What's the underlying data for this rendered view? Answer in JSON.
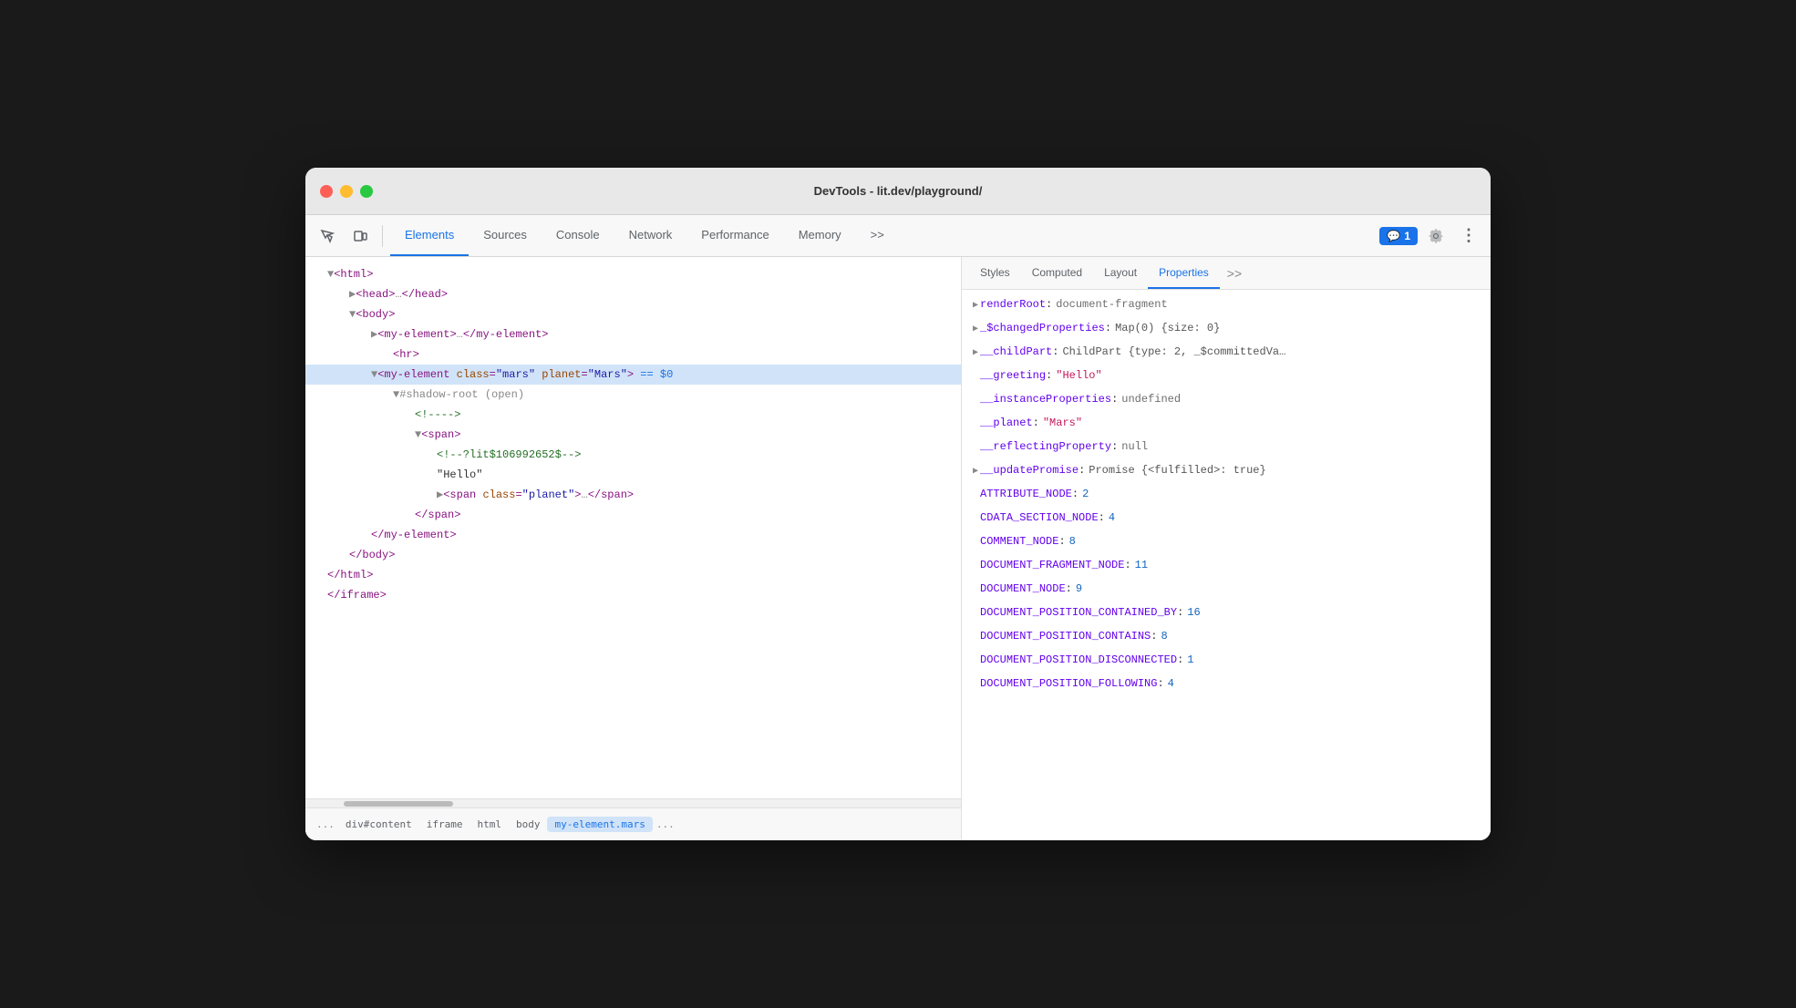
{
  "window": {
    "title": "DevTools - lit.dev/playground/"
  },
  "toolbar": {
    "tabs": [
      {
        "label": "Elements",
        "active": true
      },
      {
        "label": "Sources"
      },
      {
        "label": "Console"
      },
      {
        "label": "Network"
      },
      {
        "label": "Performance"
      },
      {
        "label": "Memory"
      },
      {
        "label": ">>"
      }
    ],
    "chat_badge": "1",
    "more_label": "⋮"
  },
  "sub_tabs": [
    {
      "label": "Styles"
    },
    {
      "label": "Computed"
    },
    {
      "label": "Layout"
    },
    {
      "label": "Properties",
      "active": true
    }
  ],
  "dom_tree": [
    {
      "indent": 1,
      "content": "▼ <html>"
    },
    {
      "indent": 2,
      "content": "▶ <head>…</head>"
    },
    {
      "indent": 2,
      "content": "▼ <body>"
    },
    {
      "indent": 3,
      "content": "▶ <my-element>…</my-element>"
    },
    {
      "indent": 4,
      "content": "<hr>"
    },
    {
      "indent": 3,
      "content": "▼ <my-element class=\"mars\" planet=\"Mars\"> == $0",
      "selected": true
    },
    {
      "indent": 4,
      "content": "▼ #shadow-root (open)"
    },
    {
      "indent": 5,
      "content": "<!---->"
    },
    {
      "indent": 5,
      "content": "▼ <span>"
    },
    {
      "indent": 6,
      "content": "<!--?lit$106992652$-->"
    },
    {
      "indent": 6,
      "content": "\"Hello\""
    },
    {
      "indent": 6,
      "content": "▶ <span class=\"planet\">…</span>"
    },
    {
      "indent": 5,
      "content": "</span>"
    },
    {
      "indent": 3,
      "content": "</my-element>"
    },
    {
      "indent": 2,
      "content": "</body>"
    },
    {
      "indent": 1,
      "content": "</html>"
    },
    {
      "indent": 1,
      "content": "</iframe>"
    }
  ],
  "breadcrumb": {
    "ellipsis": "...",
    "items": [
      {
        "label": "div#content"
      },
      {
        "label": "iframe"
      },
      {
        "label": "html"
      },
      {
        "label": "body"
      },
      {
        "label": "my-element.mars",
        "active": true
      }
    ],
    "more": "..."
  },
  "properties": [
    {
      "expandable": true,
      "key": "renderRoot",
      "value": "document-fragment",
      "type": "keyword"
    },
    {
      "expandable": true,
      "key": "_$changedProperties",
      "value": "Map(0) {size: 0}",
      "type": "object"
    },
    {
      "expandable": true,
      "key": "__childPart",
      "value": "ChildPart {type: 2, _$committedVa…",
      "type": "object"
    },
    {
      "expandable": false,
      "key": "__greeting",
      "value": "\"Hello\"",
      "type": "string"
    },
    {
      "expandable": false,
      "key": "__instanceProperties",
      "value": "undefined",
      "type": "keyword"
    },
    {
      "expandable": false,
      "key": "__planet",
      "value": "\"Mars\"",
      "type": "string"
    },
    {
      "expandable": false,
      "key": "__reflectingProperty",
      "value": "null",
      "type": "null"
    },
    {
      "expandable": true,
      "key": "__updatePromise",
      "value": "Promise {<fulfilled>: true}",
      "type": "object"
    },
    {
      "expandable": false,
      "key": "ATTRIBUTE_NODE",
      "value": "2",
      "type": "number"
    },
    {
      "expandable": false,
      "key": "CDATA_SECTION_NODE",
      "value": "4",
      "type": "number"
    },
    {
      "expandable": false,
      "key": "COMMENT_NODE",
      "value": "8",
      "type": "number"
    },
    {
      "expandable": false,
      "key": "DOCUMENT_FRAGMENT_NODE",
      "value": "11",
      "type": "number"
    },
    {
      "expandable": false,
      "key": "DOCUMENT_NODE",
      "value": "9",
      "type": "number"
    },
    {
      "expandable": false,
      "key": "DOCUMENT_POSITION_CONTAINED_BY",
      "value": "16",
      "type": "number"
    },
    {
      "expandable": false,
      "key": "DOCUMENT_POSITION_CONTAINS",
      "value": "8",
      "type": "number"
    },
    {
      "expandable": false,
      "key": "DOCUMENT_POSITION_DISCONNECTED",
      "value": "1",
      "type": "number"
    },
    {
      "expandable": false,
      "key": "DOCUMENT_POSITION_FOLLOWING",
      "value": "4",
      "type": "number"
    }
  ]
}
